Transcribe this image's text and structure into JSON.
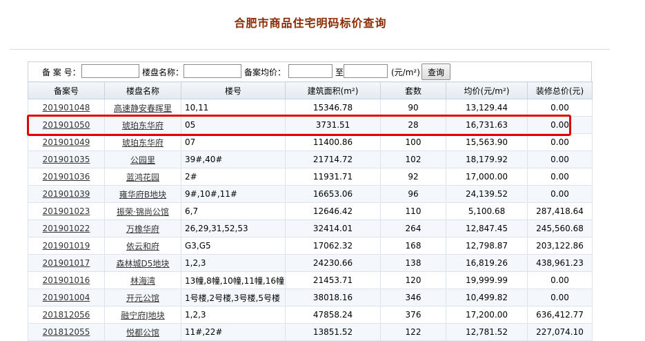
{
  "page": {
    "title": "合肥市商品住宅明码标价查询"
  },
  "search": {
    "record_no_label": "备 案 号：",
    "project_name_label": "楼盘名称：",
    "avg_price_label": "备案均价：",
    "to_label": "至",
    "unit_label": "(元/m²)",
    "query_button": "查询",
    "record_no_value": "",
    "project_name_value": "",
    "price_min_value": "",
    "price_max_value": ""
  },
  "table": {
    "headers": [
      "备案号",
      "楼盘名称",
      "楼号",
      "建筑面积(m²)",
      "套数",
      "均价(元/m²)",
      "装修总价(元)"
    ],
    "rows": [
      {
        "record": "201901048",
        "project": "高速静安春晖里",
        "building": "10,11",
        "area": "15346.78",
        "units": "90",
        "avg_price": "13,129.44",
        "decor_total": "0.00"
      },
      {
        "record": "201901050",
        "project": "琥珀东华府",
        "building": "05",
        "area": "3731.51",
        "units": "28",
        "avg_price": "16,731.63",
        "decor_total": "0.00"
      },
      {
        "record": "201901049",
        "project": "琥珀东华府",
        "building": "07",
        "area": "11400.86",
        "units": "100",
        "avg_price": "15,563.90",
        "decor_total": "0.00"
      },
      {
        "record": "201901035",
        "project": "公园里",
        "building": "39#,40#",
        "area": "21714.72",
        "units": "102",
        "avg_price": "18,179.92",
        "decor_total": "0.00"
      },
      {
        "record": "201901036",
        "project": "蓝鸿花园",
        "building": "2#",
        "area": "11931.71",
        "units": "92",
        "avg_price": "17,000.00",
        "decor_total": "0.00"
      },
      {
        "record": "201901039",
        "project": "雍华府B地块",
        "building": "9#,10#,11#",
        "area": "16653.06",
        "units": "96",
        "avg_price": "24,139.52",
        "decor_total": "0.00"
      },
      {
        "record": "201901023",
        "project": "振荣·锦尚公馆",
        "building": "6,7",
        "area": "12646.42",
        "units": "110",
        "avg_price": "5,100.68",
        "decor_total": "287,418.64"
      },
      {
        "record": "201901022",
        "project": "万橡华府",
        "building": "26,29,31,52,53",
        "area": "32414.01",
        "units": "264",
        "avg_price": "12,847.45",
        "decor_total": "245,560.68"
      },
      {
        "record": "201901019",
        "project": "依云和府",
        "building": "G3,G5",
        "area": "17062.32",
        "units": "168",
        "avg_price": "12,798.87",
        "decor_total": "203,122.86"
      },
      {
        "record": "201901017",
        "project": "森林城D5地块",
        "building": "1,2,3",
        "area": "24230.66",
        "units": "138",
        "avg_price": "16,819.26",
        "decor_total": "438,961.23"
      },
      {
        "record": "201901016",
        "project": "林海湾",
        "building": "13幢,8幢,10幢,11幢,16幢",
        "area": "21453.71",
        "units": "120",
        "avg_price": "19,999.99",
        "decor_total": "0.00"
      },
      {
        "record": "201901004",
        "project": "开元公馆",
        "building": "1号楼,2号楼,3号楼,5号楼",
        "area": "38018.16",
        "units": "346",
        "avg_price": "10,499.82",
        "decor_total": "0.00"
      },
      {
        "record": "201812056",
        "project": "融宁府J地块",
        "building": "1,2,3",
        "area": "47858.24",
        "units": "376",
        "avg_price": "17,200.00",
        "decor_total": "636,412.77"
      },
      {
        "record": "201812055",
        "project": "悦都公馆",
        "building": "11#,22#",
        "area": "13851.52",
        "units": "122",
        "avg_price": "12,781.52",
        "decor_total": "227,074.10"
      }
    ]
  },
  "colors": {
    "title": "#8b2a00",
    "highlight": "#e00000",
    "row_alt": "#f4f7fb",
    "header_bg": "#e3eaf1"
  }
}
